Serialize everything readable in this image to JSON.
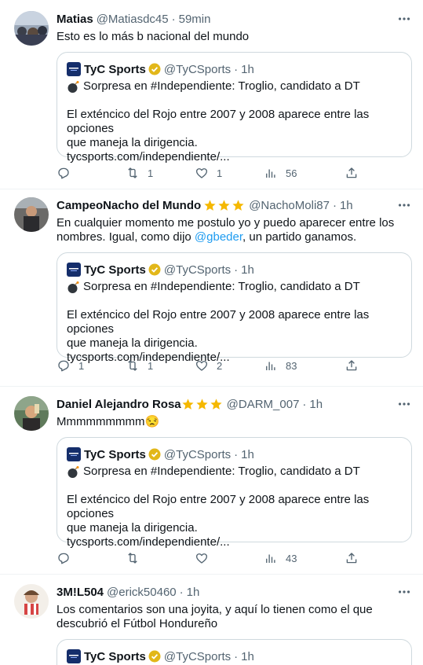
{
  "tweets": [
    {
      "name": "Matias",
      "handle": "@Matiasdc45",
      "time": "59min",
      "text": "Esto es lo más b nacional del mundo",
      "stars": 0,
      "quote": {
        "name": "TyC Sports",
        "handle": "@TyCSports",
        "time": "1h",
        "headline": "Sorpresa en #Independiente: Troglio, candidato a DT",
        "body_line1": "El exténcico del Rojo entre 2007 y 2008 aparece entre las opciones",
        "body_line2": "que maneja la dirigencia.",
        "link": "tycsports.com/independiente/..."
      },
      "counts": {
        "reply": "",
        "retweet": "1",
        "like": "1",
        "views": "56"
      }
    },
    {
      "name": "CampeoNacho del Mundo",
      "handle": "@NachoMoli87",
      "time": "1h",
      "text_before": "En cualquier momento me postulo yo y puedo aparecer entre los nombres. Igual, como dijo ",
      "mention": "@gbeder",
      "text_after": ", un partido ganamos.",
      "stars": 3,
      "quote": {
        "name": "TyC Sports",
        "handle": "@TyCSports",
        "time": "1h",
        "headline": "Sorpresa en #Independiente: Troglio, candidato a DT",
        "body_line1": "El exténcico del Rojo entre 2007 y 2008 aparece entre las opciones",
        "body_line2": "que maneja la dirigencia.",
        "link": "tycsports.com/independiente/..."
      },
      "counts": {
        "reply": "1",
        "retweet": "1",
        "like": "2",
        "views": "83"
      }
    },
    {
      "name": "Daniel Alejandro Rosa",
      "handle": "@DARM_007",
      "time": "1h",
      "text": "Mmmmmmmmm😒",
      "stars": 3,
      "quote": {
        "name": "TyC Sports",
        "handle": "@TyCSports",
        "time": "1h",
        "headline": "Sorpresa en #Independiente: Troglio, candidato a DT",
        "body_line1": "El exténcico del Rojo entre 2007 y 2008 aparece entre las opciones",
        "body_line2": "que maneja la dirigencia.",
        "link": "tycsports.com/independiente/..."
      },
      "counts": {
        "reply": "",
        "retweet": "",
        "like": "",
        "views": "43"
      }
    },
    {
      "name": "3M!L504",
      "handle": "@erick50460",
      "time": "1h",
      "text": "Los comentarios son una joyita, y aquí lo tienen como el que descubrió el Fútbol Hondureño",
      "stars": 0,
      "quote": {
        "name": "TyC Sports",
        "handle": "@TyCSports",
        "time": "1h"
      }
    }
  ],
  "separator": "·",
  "colors": {
    "accent": "#1d9bf0",
    "secondary_text": "#536471",
    "star": "#f5b800",
    "verified": "#e2b719"
  }
}
